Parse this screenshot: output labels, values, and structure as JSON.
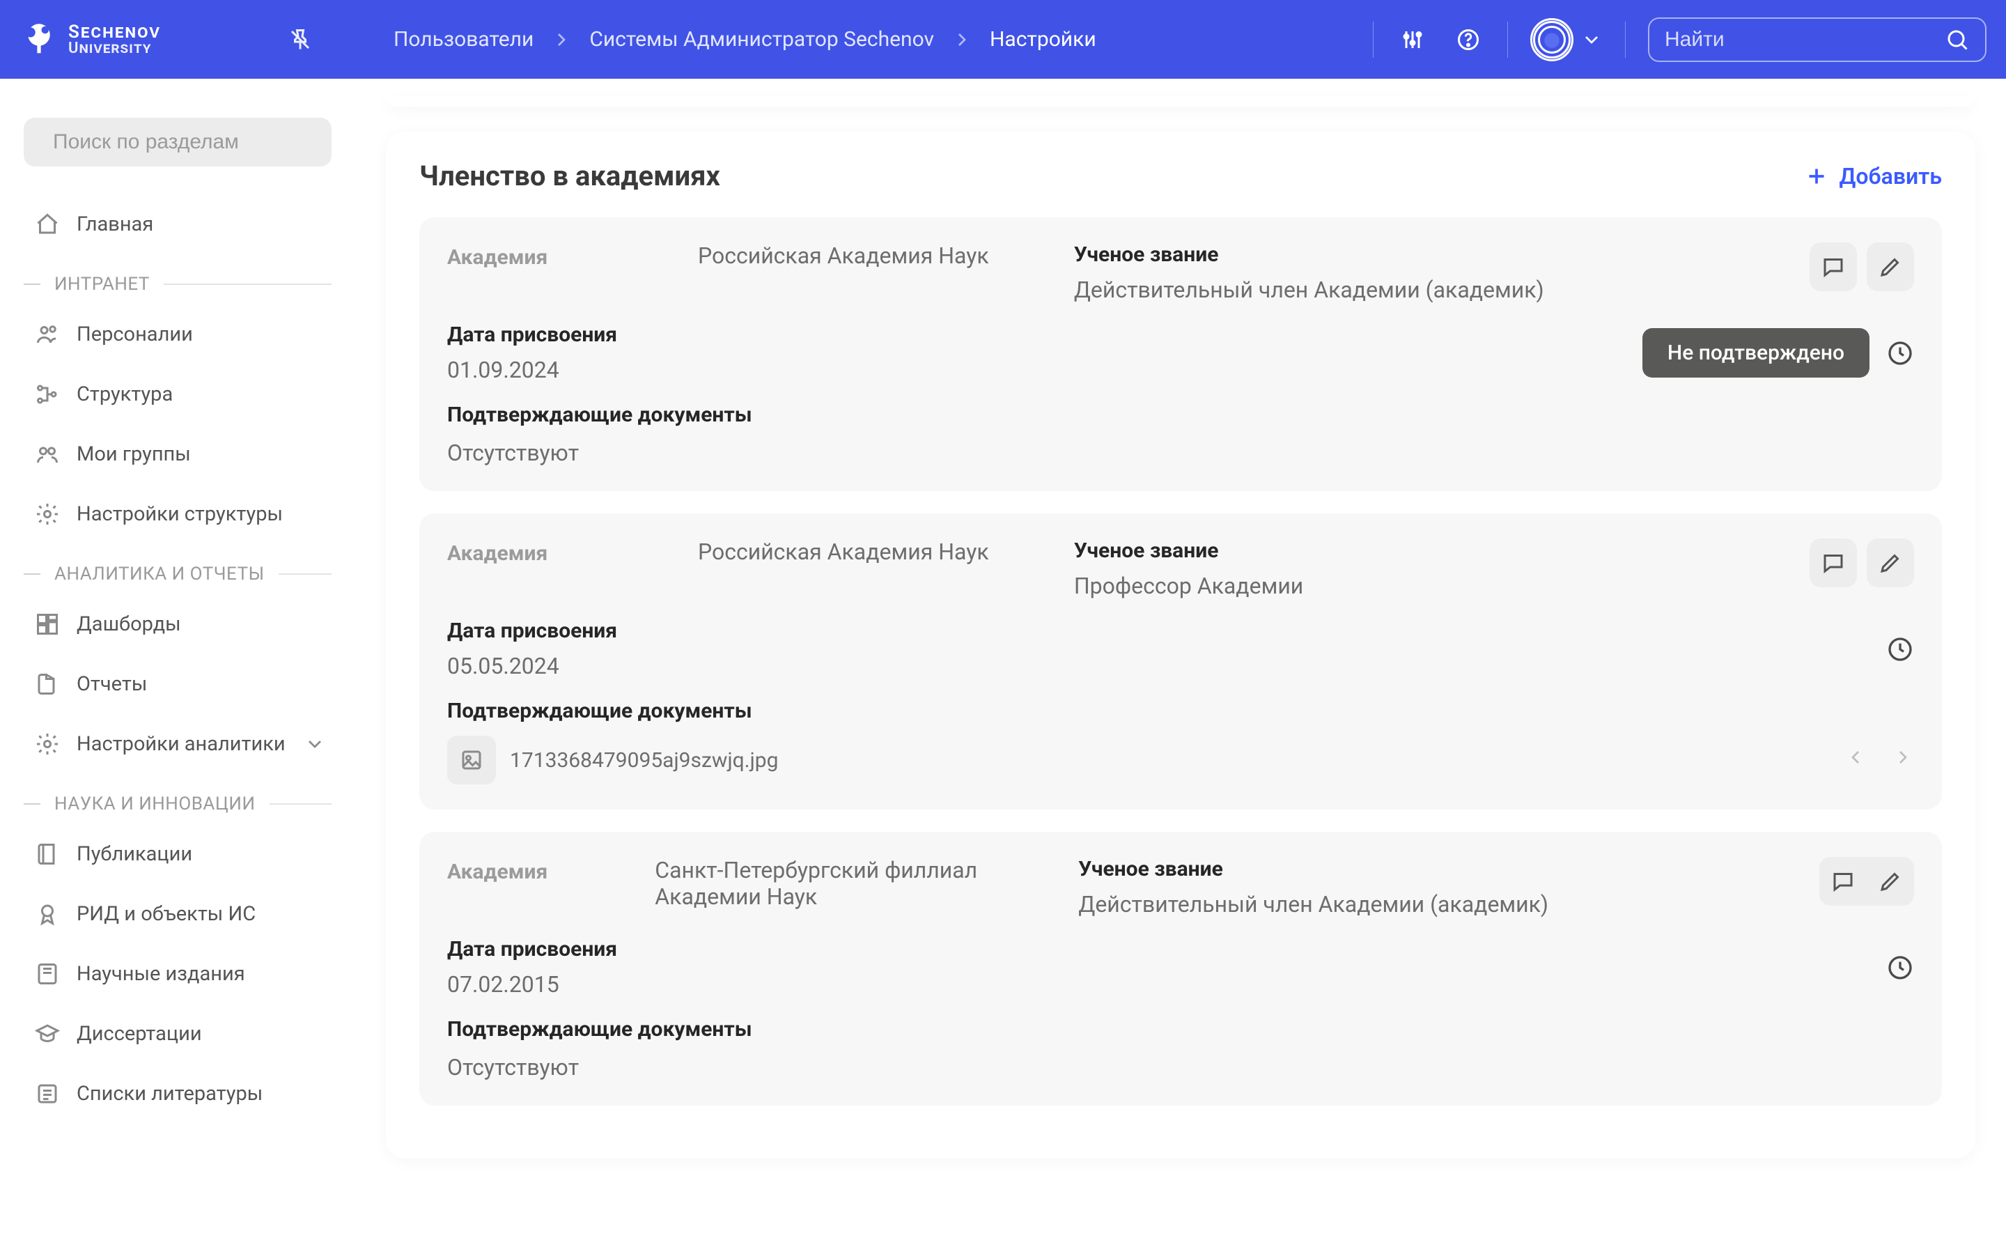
{
  "logo": {
    "line1": "Sechenov",
    "line2": "University"
  },
  "breadcrumbs": [
    "Пользователи",
    "Системы Администратор Sechenov",
    "Настройки"
  ],
  "search_placeholder": "Найти",
  "sidebar": {
    "search_placeholder": "Поиск по разделам",
    "items": [
      {
        "icon": "home",
        "label": "Главная"
      }
    ],
    "groups": [
      {
        "title": "ИНТРАНЕТ",
        "items": [
          {
            "icon": "users",
            "label": "Персоналии"
          },
          {
            "icon": "tree",
            "label": "Структура"
          },
          {
            "icon": "group",
            "label": "Мои группы"
          },
          {
            "icon": "gear",
            "label": "Настройки структуры"
          }
        ]
      },
      {
        "title": "АНАЛИТИКА И ОТЧЕТЫ",
        "items": [
          {
            "icon": "dash",
            "label": "Дашборды"
          },
          {
            "icon": "report",
            "label": "Отчеты"
          },
          {
            "icon": "gear2",
            "label": "Настройки аналитики",
            "chev": true
          }
        ]
      },
      {
        "title": "НАУКА И ИННОВАЦИИ",
        "items": [
          {
            "icon": "pub",
            "label": "Публикации"
          },
          {
            "icon": "ip",
            "label": "РИД и объекты ИС"
          },
          {
            "icon": "journal",
            "label": "Научные издания"
          },
          {
            "icon": "diss",
            "label": "Диссертации"
          },
          {
            "icon": "list",
            "label": "Списки литературы"
          }
        ]
      }
    ]
  },
  "section": {
    "title": "Членство в академиях",
    "add_label": "Добавить"
  },
  "labels": {
    "academy": "Академия",
    "rank": "Ученое звание",
    "date": "Дата присвоения",
    "docs": "Подтверждающие документы",
    "none": "Отсутствуют",
    "status_unconfirmed": "Не подтверждено"
  },
  "cards": [
    {
      "academy": "Российская Академия Наук",
      "rank": "Действительный член Академии (академик)",
      "date": "01.09.2024",
      "status": "unconfirmed",
      "doc": null
    },
    {
      "academy": "Российская Академия Наук",
      "rank": "Профессор Академии",
      "date": "05.05.2024",
      "status": null,
      "doc": "1713368479095aj9szwjq.jpg"
    },
    {
      "academy": "Санкт-Петербургский филлиал Академии Наук",
      "rank": "Действительный член Академии (академик)",
      "date": "07.02.2015",
      "status": null,
      "doc": null
    }
  ]
}
